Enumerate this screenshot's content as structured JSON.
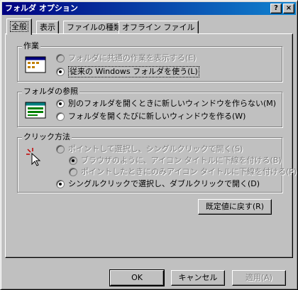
{
  "window": {
    "title": "フォルダ オプション",
    "help_label": "?",
    "close_label": "×"
  },
  "tabs": [
    {
      "label": "全般",
      "active": true
    },
    {
      "label": "表示",
      "active": false
    },
    {
      "label": "ファイルの種類",
      "active": false
    },
    {
      "label": "オフライン ファイル",
      "active": false
    }
  ],
  "groups": {
    "tasks": {
      "title": "作業",
      "options": [
        {
          "label": "フォルダに共通の作業を表示する(E)",
          "checked": false,
          "enabled": false
        },
        {
          "label": "従来の Windows フォルダを使う(L)",
          "checked": true,
          "enabled": true
        }
      ]
    },
    "browse": {
      "title": "フォルダの参照",
      "options": [
        {
          "label": "別のフォルダを開くときに新しいウィンドウを作らない(M)",
          "checked": true,
          "enabled": true
        },
        {
          "label": "フォルダを開くたびに新しいウィンドウを作る(W)",
          "checked": false,
          "enabled": true
        }
      ]
    },
    "click": {
      "title": "クリック方法",
      "options": [
        {
          "label": "ポイントして選択し、シングルクリックで開く(S)",
          "checked": false,
          "enabled": false
        },
        {
          "label": "ブラウザのように、アイコン タイトルに下線を付ける(B)",
          "checked": true,
          "enabled": false
        },
        {
          "label": "ポイントしたときにのみアイコン タイトルに下線を付ける(P)",
          "checked": false,
          "enabled": false
        },
        {
          "label": "シングルクリックで選択し、ダブルクリックで開く(D)",
          "checked": true,
          "enabled": true
        }
      ]
    }
  },
  "buttons": {
    "restore_defaults": "既定値に戻す(R)",
    "ok": "OK",
    "cancel": "キャンセル",
    "apply": "適用(A)"
  },
  "colors": {
    "title_start": "#000080",
    "title_end": "#1084d0",
    "face": "#c0c0c0"
  }
}
